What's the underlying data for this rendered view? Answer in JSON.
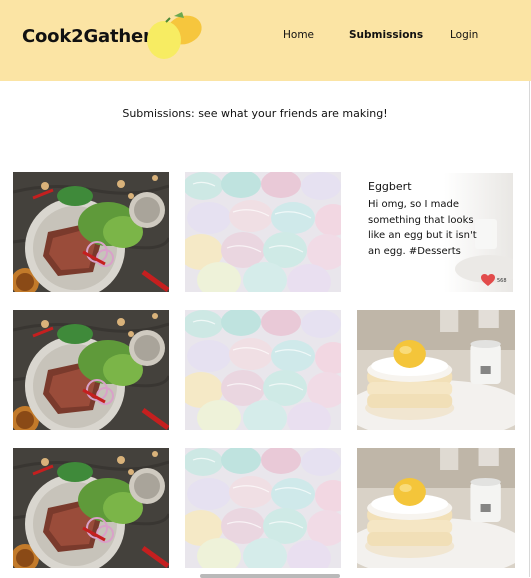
{
  "header": {
    "brand": "Cook2Gather",
    "nav": [
      {
        "label": "Home"
      },
      {
        "label": "Submissions",
        "active": true
      },
      {
        "label": "Login"
      }
    ],
    "background": "#fbe4a4"
  },
  "page": {
    "subtitle": "Submissions: see what your friends are making!"
  },
  "gallery": {
    "rows": [
      [
        "steak-salad-photo",
        "pastel-cake-pops-photo",
        "post-card"
      ],
      [
        "steak-salad-photo",
        "pastel-cake-pops-photo",
        "souffle-pancakes-photo"
      ],
      [
        "steak-salad-photo",
        "pastel-cake-pops-photo",
        "souffle-pancakes-photo"
      ]
    ],
    "post": {
      "author": "Eggbert",
      "text": "Hi omg, so I made something that looks like an egg but it isn't an egg. #Desserts",
      "likes": "568",
      "like_color": "#e24b4b"
    }
  }
}
